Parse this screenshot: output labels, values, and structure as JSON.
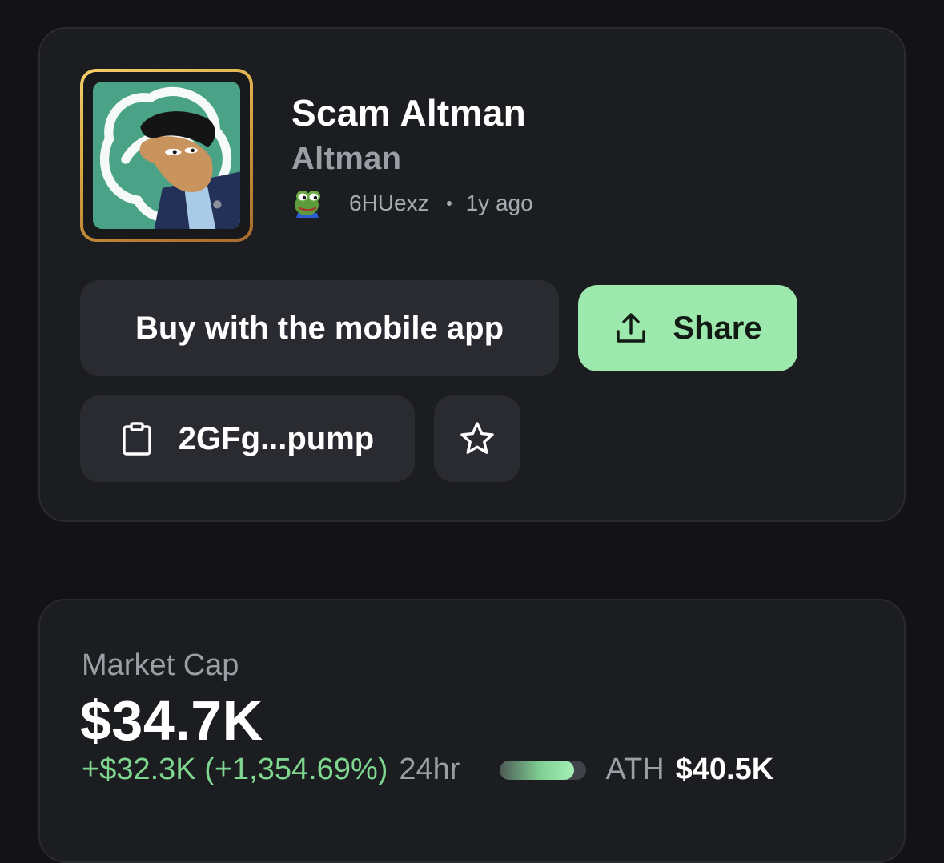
{
  "token": {
    "name": "Scam Altman",
    "ticker": "Altman",
    "creator": "6HUexz",
    "age": "1y ago",
    "image_icon": "token-avatar-image",
    "creator_icon": "pepe-avatar-icon"
  },
  "actions": {
    "buy_label": "Buy with the mobile app",
    "share_label": "Share",
    "share_icon": "share-upload-icon",
    "address_label": "2GFg...pump",
    "address_icon": "clipboard-icon",
    "favorite_icon": "star-icon"
  },
  "market": {
    "label": "Market Cap",
    "value": "$34.7K",
    "change": "+$32.3K (+1,354.69%)",
    "period": "24hr",
    "ath_label": "ATH",
    "ath_value": "$40.5K",
    "ath_progress": 0.857
  },
  "colors": {
    "background": "#131316",
    "card": "#1c1d20",
    "button": "#2a2b30",
    "accent_green": "#9ce8ad",
    "positive": "#7fd68f",
    "muted": "#9c9ea6",
    "gold_frame": "#d9a441"
  }
}
